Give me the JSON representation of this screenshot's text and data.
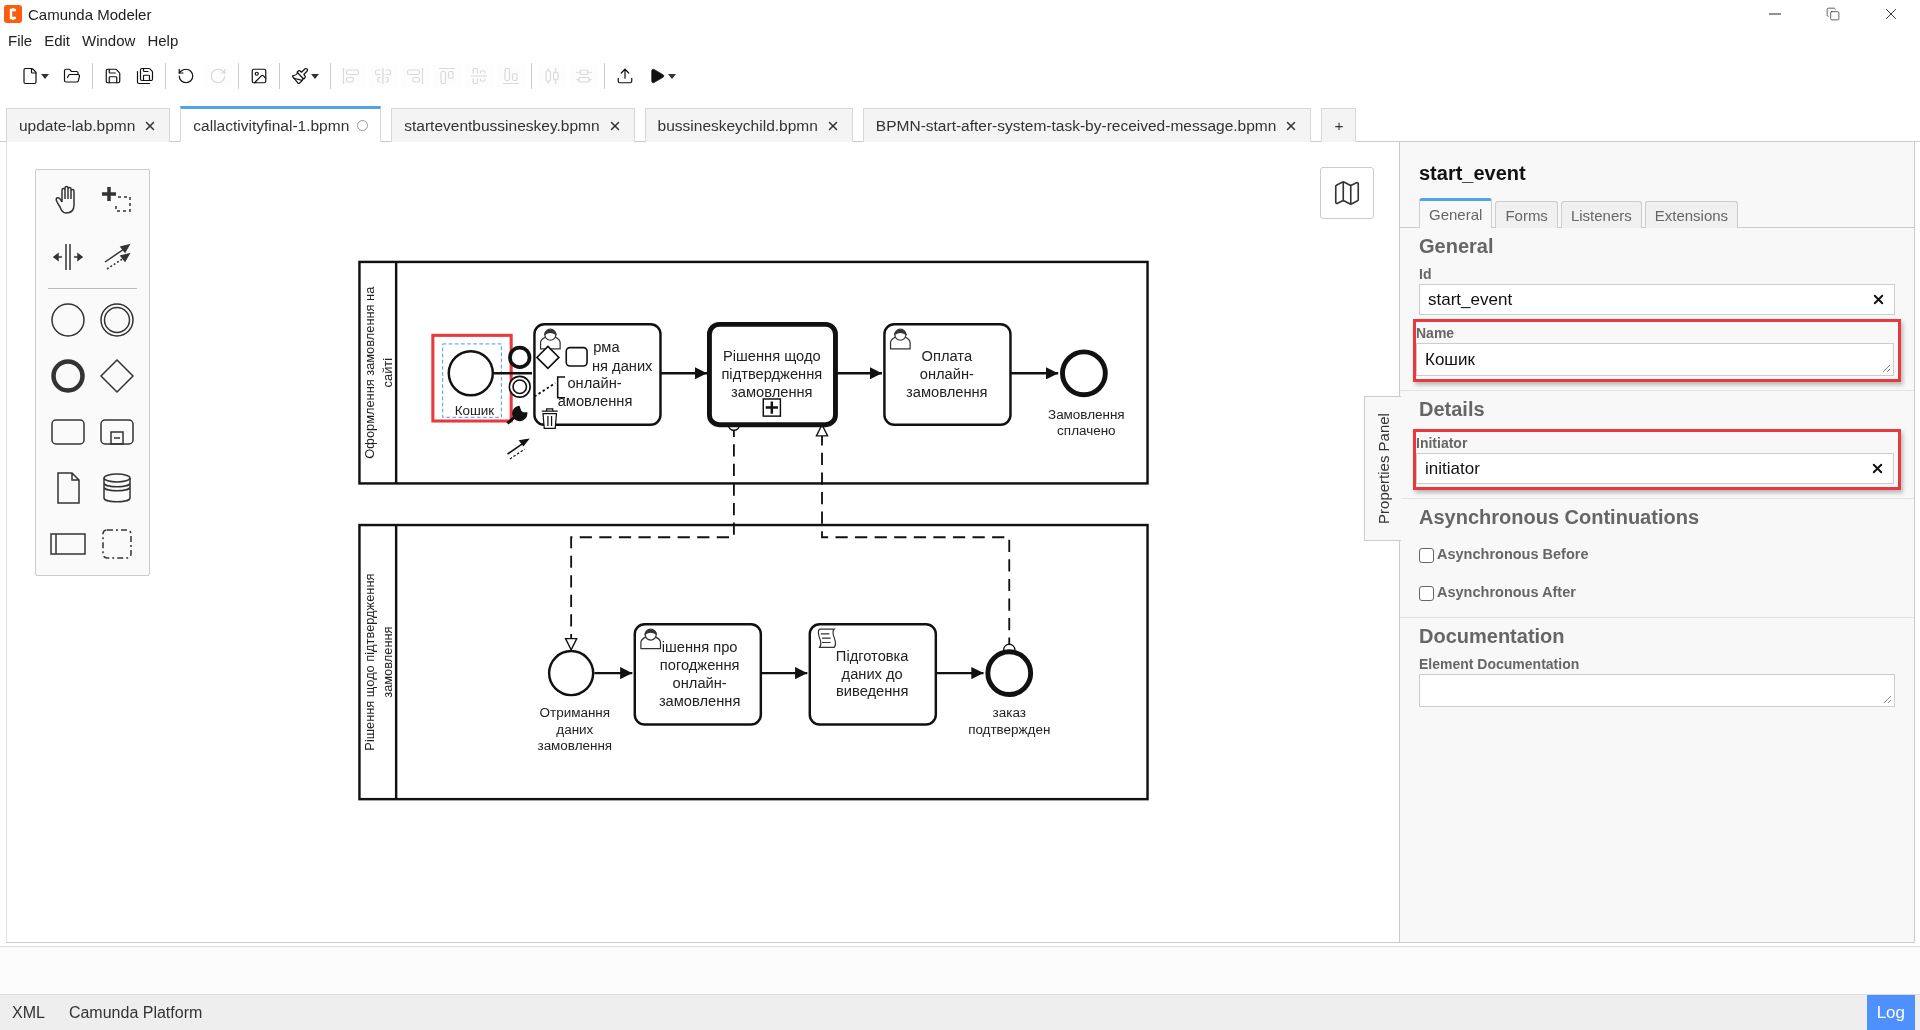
{
  "window": {
    "title": "Camunda Modeler"
  },
  "menu": [
    {
      "label": "File"
    },
    {
      "label": "Edit"
    },
    {
      "label": "Window"
    },
    {
      "label": "Help"
    }
  ],
  "toolbar": [
    [
      {
        "kind": "new",
        "disabled": false,
        "has_menu": true
      },
      {
        "kind": "open",
        "disabled": false,
        "has_menu": false
      }
    ],
    [
      {
        "kind": "save",
        "disabled": false,
        "has_menu": false
      },
      {
        "kind": "save-as",
        "disabled": false,
        "has_menu": false
      }
    ],
    [
      {
        "kind": "undo",
        "disabled": false,
        "has_menu": false
      },
      {
        "kind": "redo",
        "disabled": true,
        "has_menu": false
      }
    ],
    [
      {
        "kind": "image",
        "disabled": false,
        "has_menu": false
      }
    ],
    [
      {
        "kind": "color",
        "disabled": false,
        "has_menu": true
      }
    ],
    [
      {
        "kind": "align-left",
        "disabled": true,
        "has_menu": false
      },
      {
        "kind": "align-center",
        "disabled": true,
        "has_menu": false
      },
      {
        "kind": "align-right",
        "disabled": true,
        "has_menu": false
      },
      {
        "kind": "align-top",
        "disabled": true,
        "has_menu": false
      },
      {
        "kind": "align-middle",
        "disabled": true,
        "has_menu": false
      },
      {
        "kind": "align-bottom",
        "disabled": true,
        "has_menu": false
      }
    ],
    [
      {
        "kind": "distribute-h",
        "disabled": true,
        "has_menu": false
      },
      {
        "kind": "distribute-v",
        "disabled": true,
        "has_menu": false
      }
    ],
    [
      {
        "kind": "deploy",
        "disabled": false,
        "has_menu": false
      },
      {
        "kind": "run",
        "disabled": false,
        "has_menu": true
      }
    ]
  ],
  "tabs": [
    {
      "label": "update-lab.bpmn",
      "selected": false,
      "unsaved": false
    },
    {
      "label": "callactivityfinal-1.bpmn",
      "selected": true,
      "unsaved": true
    },
    {
      "label": "starteventbussineskey.bpmn",
      "selected": false,
      "unsaved": false
    },
    {
      "label": "bussineskeychild.bpmn",
      "selected": false,
      "unsaved": false
    },
    {
      "label": "BPMN-start-after-system-task-by-received-message.bpmn",
      "selected": false,
      "unsaved": false
    }
  ],
  "new_tab": "+",
  "diagram": {
    "pools": [
      {
        "label": [
          "Оформлення замовлення на",
          "сайті"
        ],
        "elements": [
          {
            "kind": "start-event",
            "label": [
              "Кошик"
            ],
            "selected": true,
            "highlighted": true
          },
          {
            "kind": "user-task",
            "label": [
              "рма",
              "ня даних",
              "онлайн-",
              "амовлення"
            ],
            "selected": false,
            "highlighted": false
          },
          {
            "kind": "subprocess",
            "label": [
              "Рішення щодо",
              "підтвердження",
              "замовлення"
            ],
            "selected": false,
            "highlighted": false
          },
          {
            "kind": "user-task",
            "label": [
              "Оплата",
              "онлайн-",
              "замовлення"
            ],
            "selected": false,
            "highlighted": false
          },
          {
            "kind": "end-event",
            "label": [
              "Замовлення",
              "сплачено"
            ],
            "selected": false,
            "highlighted": false
          }
        ]
      },
      {
        "label": [
          "Рішення щодо підтвердження",
          "замовлення"
        ],
        "elements": [
          {
            "kind": "start-event",
            "label": [
              "Отримання",
              "даних",
              "замовлення"
            ],
            "selected": false,
            "highlighted": false
          },
          {
            "kind": "user-task",
            "label": [
              "ішення про",
              "погодження",
              "онлайн-",
              "замовлення"
            ],
            "selected": false,
            "highlighted": false
          },
          {
            "kind": "script-task",
            "label": [
              "Підготовка",
              "даних до",
              "виведення"
            ],
            "selected": false,
            "highlighted": false
          },
          {
            "kind": "end-event",
            "label": [
              "заказ",
              "подтвержден"
            ],
            "selected": false,
            "highlighted": false
          }
        ]
      }
    ]
  },
  "properties": {
    "title": "start_event",
    "side_tab": "Properties Panel",
    "tabs": [
      {
        "label": "General",
        "selected": true
      },
      {
        "label": "Forms",
        "selected": false
      },
      {
        "label": "Listeners",
        "selected": false
      },
      {
        "label": "Extensions",
        "selected": false
      }
    ],
    "sections": [
      {
        "heading": "General",
        "fields": [
          {
            "kind": "input",
            "label": "Id",
            "value": "start_event",
            "highlighted": false
          },
          {
            "kind": "textarea",
            "label": "Name",
            "value": "Кошик",
            "highlighted": true
          }
        ]
      },
      {
        "heading": "Details",
        "fields": [
          {
            "kind": "input",
            "label": "Initiator",
            "value": "initiator",
            "highlighted": true
          }
        ]
      },
      {
        "heading": "Asynchronous Continuations",
        "fields": [
          {
            "kind": "checkbox",
            "label": "Asynchronous Before",
            "checked": false
          },
          {
            "kind": "checkbox",
            "label": "Asynchronous After",
            "checked": false
          }
        ]
      },
      {
        "heading": "Documentation",
        "fields": [
          {
            "kind": "textarea",
            "label": "Element Documentation",
            "highlighted": false
          }
        ]
      }
    ]
  },
  "status_bar": {
    "items": [
      "XML",
      "Camunda Platform"
    ],
    "log": "Log"
  }
}
